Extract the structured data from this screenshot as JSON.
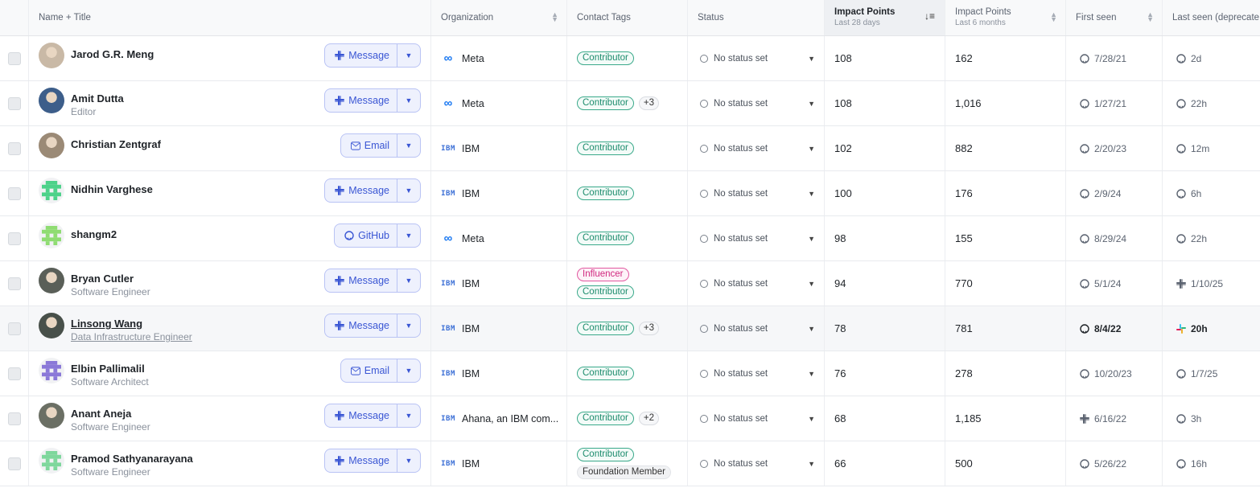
{
  "columns": {
    "name": "Name + Title",
    "organization": "Organization",
    "contact_tags": "Contact Tags",
    "status": "Status",
    "impact_28": {
      "title": "Impact Points",
      "sub": "Last 28 days"
    },
    "impact_6m": {
      "title": "Impact Points",
      "sub": "Last 6 months"
    },
    "first_seen": "First seen",
    "last_seen": "Last seen (deprecate"
  },
  "status_placeholder": "No status set",
  "rows": [
    {
      "name": "Jarod G.R. Meng",
      "title": "",
      "action": "Message",
      "action_icon": "slack-icon",
      "org": "Meta",
      "org_logo": "meta-logo",
      "tags": [
        "Contributor"
      ],
      "more": "",
      "imp28": "108",
      "imp6": "162",
      "first": "7/28/21",
      "first_icon": "github-icon",
      "last": "2d",
      "last_icon": "github-icon",
      "avatar_color": "#c9b9a6"
    },
    {
      "name": "Amit Dutta",
      "title": "Editor",
      "action": "Message",
      "action_icon": "slack-icon",
      "org": "Meta",
      "org_logo": "meta-logo",
      "tags": [
        "Contributor"
      ],
      "more": "+3",
      "imp28": "108",
      "imp6": "1,016",
      "first": "1/27/21",
      "first_icon": "github-icon",
      "last": "22h",
      "last_icon": "github-icon",
      "avatar_color": "#3d5e8a"
    },
    {
      "name": "Christian Zentgraf",
      "title": "",
      "action": "Email",
      "action_icon": "mail-icon",
      "org": "IBM",
      "org_logo": "ibm-logo",
      "tags": [
        "Contributor"
      ],
      "more": "",
      "imp28": "102",
      "imp6": "882",
      "first": "2/20/23",
      "first_icon": "github-icon",
      "last": "12m",
      "last_icon": "github-icon",
      "avatar_color": "#9b8a76"
    },
    {
      "name": "Nidhin Varghese",
      "title": "",
      "action": "Message",
      "action_icon": "slack-icon",
      "org": "IBM",
      "org_logo": "ibm-logo",
      "tags": [
        "Contributor"
      ],
      "more": "",
      "imp28": "100",
      "imp6": "176",
      "first": "2/9/24",
      "first_icon": "github-icon",
      "last": "6h",
      "last_icon": "github-icon",
      "avatar_color": "identicon-green"
    },
    {
      "name": "shangm2",
      "title": "",
      "action": "GitHub",
      "action_icon": "github-icon",
      "org": "Meta",
      "org_logo": "meta-logo",
      "tags": [
        "Contributor"
      ],
      "more": "",
      "imp28": "98",
      "imp6": "155",
      "first": "8/29/24",
      "first_icon": "github-icon",
      "last": "22h",
      "last_icon": "github-icon",
      "avatar_color": "identicon-lime"
    },
    {
      "name": "Bryan Cutler",
      "title": "Software Engineer",
      "action": "Message",
      "action_icon": "slack-icon",
      "org": "IBM",
      "org_logo": "ibm-logo",
      "tags": [
        "Influencer",
        "Contributor"
      ],
      "more": "",
      "imp28": "94",
      "imp6": "770",
      "first": "5/1/24",
      "first_icon": "github-icon",
      "last": "1/10/25",
      "last_icon": "slack-icon",
      "avatar_color": "#5a5f58"
    },
    {
      "name": "Linsong Wang",
      "title": "Data Infrastructure Engineer",
      "action": "Message",
      "action_icon": "slack-icon",
      "org": "IBM",
      "org_logo": "ibm-logo",
      "tags": [
        "Contributor"
      ],
      "more": "+3",
      "imp28": "78",
      "imp6": "781",
      "first": "8/4/22",
      "first_icon": "github-icon",
      "last": "20h",
      "last_icon": "slack-color-icon",
      "avatar_color": "#48504a"
    },
    {
      "name": "Elbin Pallimalil",
      "title": "Software Architect",
      "action": "Email",
      "action_icon": "mail-icon",
      "org": "IBM",
      "org_logo": "ibm-logo",
      "tags": [
        "Contributor"
      ],
      "more": "",
      "imp28": "76",
      "imp6": "278",
      "first": "10/20/23",
      "first_icon": "github-icon",
      "last": "1/7/25",
      "last_icon": "github-icon",
      "avatar_color": "identicon-purple"
    },
    {
      "name": "Anant Aneja",
      "title": "Software Engineer",
      "action": "Message",
      "action_icon": "slack-icon",
      "org": "Ahana, an IBM com...",
      "org_logo": "ibm-logo",
      "tags": [
        "Contributor"
      ],
      "more": "+2",
      "imp28": "68",
      "imp6": "1,185",
      "first": "6/16/22",
      "first_icon": "slack-icon",
      "last": "3h",
      "last_icon": "github-icon",
      "avatar_color": "#6b6f64"
    },
    {
      "name": "Pramod Sathyanarayana",
      "title": "Software Engineer",
      "action": "Message",
      "action_icon": "slack-icon",
      "org": "IBM",
      "org_logo": "ibm-logo",
      "tags": [
        "Contributor",
        "Foundation Member"
      ],
      "more": "",
      "imp28": "66",
      "imp6": "500",
      "first": "5/26/22",
      "first_icon": "github-icon",
      "last": "16h",
      "last_icon": "github-icon",
      "avatar_color": "identicon-mint"
    }
  ]
}
